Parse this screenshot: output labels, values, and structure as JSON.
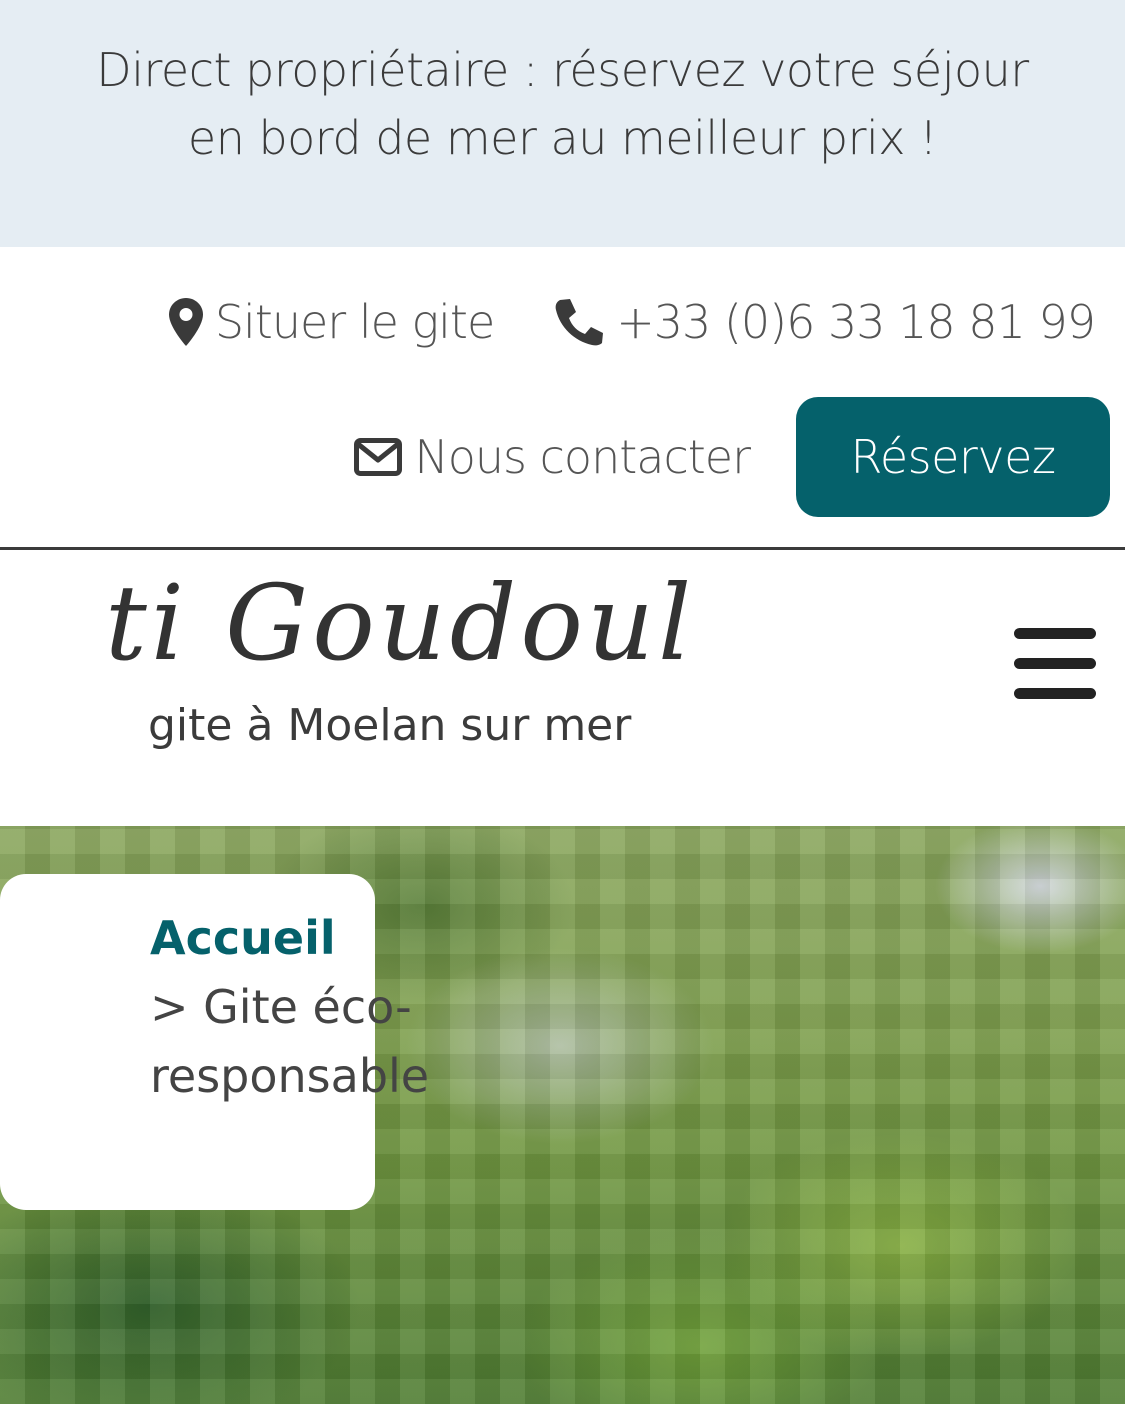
{
  "promo_banner": {
    "text": "Direct propriétaire : réservez votre séjour en bord de mer au meilleur prix !"
  },
  "topbar": {
    "locate_label": "Situer le gite",
    "locate_icon": "map-marker-icon",
    "phone_label": "+33 (0)6 33 18 81 99",
    "phone_icon": "phone-icon",
    "contact_label": "Nous contacter",
    "contact_icon": "envelope-icon",
    "reserve_label": "Réservez"
  },
  "brand": {
    "logo": "ti Goudoul",
    "tagline": "gite à Moelan sur mer",
    "menu_icon": "hamburger-menu-icon"
  },
  "breadcrumb": {
    "home": "Accueil",
    "current": "> Gite éco-responsable"
  },
  "colors": {
    "accent": "#05616b",
    "banner_bg": "#e5edf3",
    "text": "#3b3b3b"
  }
}
